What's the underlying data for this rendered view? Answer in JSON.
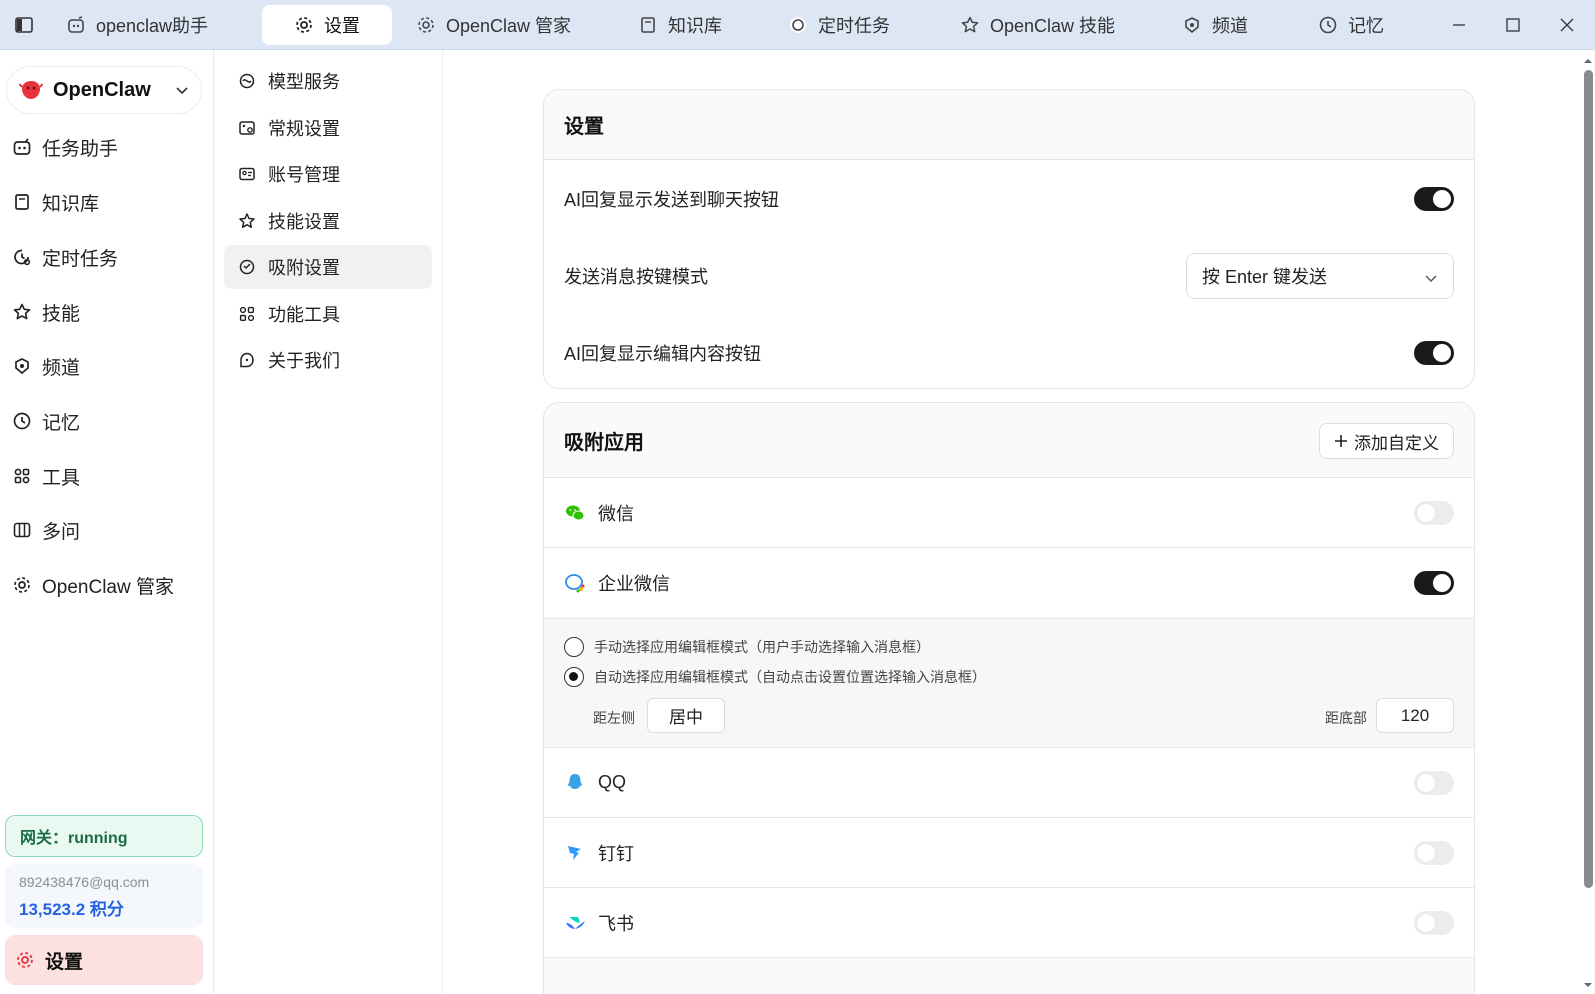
{
  "tabs": [
    {
      "label": "openclaw助手",
      "icon": "robot-icon"
    },
    {
      "label": "设置",
      "icon": "gear-icon"
    },
    {
      "label": "OpenClaw 管家",
      "icon": "gear-icon"
    },
    {
      "label": "知识库",
      "icon": "book-icon"
    },
    {
      "label": "定时任务",
      "icon": "clock-circle-icon"
    },
    {
      "label": "OpenClaw 技能",
      "icon": "star-icon"
    },
    {
      "label": "频道",
      "icon": "channel-icon"
    },
    {
      "label": "记忆",
      "icon": "history-icon"
    }
  ],
  "brand": {
    "name": "OpenClaw"
  },
  "sidebar": {
    "items": [
      {
        "label": "任务助手",
        "icon": "robot-icon"
      },
      {
        "label": "知识库",
        "icon": "book-icon"
      },
      {
        "label": "定时任务",
        "icon": "timer-icon"
      },
      {
        "label": "技能",
        "icon": "star-icon"
      },
      {
        "label": "频道",
        "icon": "channel-icon"
      },
      {
        "label": "记忆",
        "icon": "history-icon"
      },
      {
        "label": "工具",
        "icon": "tools-icon"
      },
      {
        "label": "多问",
        "icon": "columns-icon"
      },
      {
        "label": "OpenClaw 管家",
        "icon": "gear-icon"
      }
    ],
    "gateway": "网关：running",
    "account": {
      "email": "892438476@qq.com",
      "points": "13,523.2 积分"
    },
    "settings_label": "设置"
  },
  "submenu": {
    "items": [
      {
        "label": "模型服务",
        "icon": "model-icon"
      },
      {
        "label": "常规设置",
        "icon": "image-settings-icon"
      },
      {
        "label": "账号管理",
        "icon": "id-card-icon"
      },
      {
        "label": "技能设置",
        "icon": "star-icon"
      },
      {
        "label": "吸附设置",
        "icon": "magnet-icon"
      },
      {
        "label": "功能工具",
        "icon": "apps-icon"
      },
      {
        "label": "关于我们",
        "icon": "info-icon"
      }
    ],
    "active_index": 4
  },
  "settings_card": {
    "title": "设置",
    "rows": [
      {
        "label": "AI回复显示发送到聊天按钮",
        "toggle": true
      },
      {
        "label": "发送消息按键模式",
        "select": "按 Enter 键发送"
      },
      {
        "label": "AI回复显示编辑内容按钮",
        "toggle": true
      }
    ]
  },
  "attach_card": {
    "title": "吸附应用",
    "add_label": "添加自定义",
    "apps": [
      {
        "name": "微信",
        "icon": "wechat-icon",
        "enabled": false
      },
      {
        "name": "企业微信",
        "icon": "wecom-icon",
        "enabled": true
      },
      {
        "name": "QQ",
        "icon": "qq-icon",
        "enabled": false
      },
      {
        "name": "钉钉",
        "icon": "dingtalk-icon",
        "enabled": false
      },
      {
        "name": "飞书",
        "icon": "feishu-icon",
        "enabled": false
      }
    ],
    "mode_options": [
      {
        "label": "手动选择应用编辑框模式（用户手动选择输入消息框）",
        "checked": false
      },
      {
        "label": "自动选择应用编辑框模式（自动点击设置位置选择输入消息框）",
        "checked": true
      }
    ],
    "position": {
      "left_label": "距左侧",
      "left_value": "居中",
      "bottom_label": "距底部",
      "bottom_value": "120"
    }
  },
  "colors": {
    "titlebar": "#dde6f5",
    "gateway_bg": "#e9f9f1",
    "gateway_text": "#1c6b46",
    "points": "#2663e0",
    "settings_btn": "#fde1e1",
    "toggle_on": "#1a1a1a",
    "brand_red": "#e8323c"
  }
}
